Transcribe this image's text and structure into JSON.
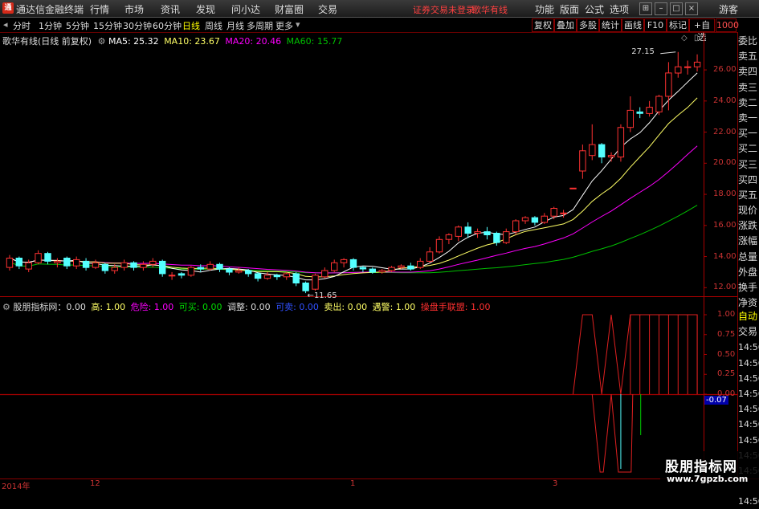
{
  "menubar": {
    "app_title": "通达信金融终端",
    "items": [
      "行情",
      "市场",
      "资讯",
      "发现",
      "问小达",
      "财富圈",
      "交易"
    ],
    "warning": "证券交易未登录",
    "stock_name": "歌华有线",
    "right_items": [
      "功能",
      "版面",
      "公式",
      "选项"
    ],
    "guest": "游客"
  },
  "periodbar": {
    "items": [
      "分时",
      "1分钟",
      "5分钟",
      "15分钟",
      "30分钟",
      "60分钟",
      "日线",
      "周线",
      "月线",
      "多周期",
      "更多"
    ],
    "active": "日线",
    "tools": [
      "复权",
      "叠加",
      "多股",
      "统计",
      "画线",
      "F10",
      "标记",
      "+自选"
    ]
  },
  "main_legend": {
    "title": "歌华有线(日线 前复权)",
    "ma5": "MA5: 25.32",
    "ma10": "MA10: 23.67",
    "ma20": "MA20: 20.46",
    "ma60": "MA60: 15.77",
    "high_label": "27.15",
    "low_label": "11.65"
  },
  "colors": {
    "up": "#ff3232",
    "down": "#54ffff",
    "ma5": "#ffffff",
    "ma10": "#ffff66",
    "ma20": "#ff00ff",
    "ma60": "#00c000",
    "frame": "#aa0000"
  },
  "price_axis": [
    "26.00",
    "24.00",
    "22.00",
    "20.00",
    "18.00",
    "16.00",
    "14.00",
    "12.00"
  ],
  "right_panel": [
    "委比",
    "卖五",
    "卖四",
    "卖三",
    "卖二",
    "卖一",
    "买一",
    "买二",
    "买三",
    "买四",
    "买五",
    "现价",
    "涨跌",
    "涨幅",
    "总量",
    "外盘",
    "换手",
    "净资",
    "收益"
  ],
  "right_panel_lower": [
    "自动",
    "交易"
  ],
  "time_labels": [
    "14:56",
    "14:56",
    "14:56",
    "14:56",
    "14:56",
    "14:56",
    "14:56",
    "14:56",
    "14:56",
    "14:56",
    "14:56"
  ],
  "indicator": {
    "name": "股朋指标网：0.00",
    "gao": "高: 1.00",
    "weixian": "危险: 1.00",
    "kemai": "可买: 0.00",
    "tiaozheng": "调整: 0.00",
    "kemai2": "可卖: 0.00",
    "maichu": "卖出: 0.00",
    "yujing": "遇警: 1.00",
    "caopan": "操盘手联盟: 1.00",
    "axis": [
      "1.00",
      "0.75",
      "0.50",
      "0.25",
      "0.00"
    ],
    "current": "-0.07"
  },
  "date_axis": [
    "2014年",
    "12",
    "1",
    "3"
  ],
  "watermark": {
    "line1": "股朋指标网",
    "line2": "www.7gpzb.com"
  },
  "chart_data": {
    "type": "candlestick",
    "title": "歌华有线(日线 前复权)",
    "ylim": [
      11.5,
      27.5
    ],
    "candles": [
      [
        13.3,
        13.9,
        13.1,
        14.1
      ],
      [
        13.9,
        13.4,
        13.2,
        14.0
      ],
      [
        13.2,
        13.6,
        13.0,
        13.8
      ],
      [
        13.6,
        14.2,
        13.5,
        14.4
      ],
      [
        14.2,
        13.7,
        13.5,
        14.3
      ],
      [
        13.6,
        13.7,
        13.3,
        13.9
      ],
      [
        13.9,
        13.4,
        13.2,
        14.0
      ],
      [
        13.4,
        13.8,
        13.2,
        14.0
      ],
      [
        13.7,
        13.3,
        13.1,
        13.9
      ],
      [
        13.3,
        13.6,
        13.2,
        13.8
      ],
      [
        13.5,
        13.1,
        12.9,
        13.6
      ],
      [
        13.1,
        13.3,
        12.9,
        13.5
      ],
      [
        13.3,
        13.6,
        13.1,
        13.8
      ],
      [
        13.6,
        13.3,
        13.1,
        13.7
      ],
      [
        13.3,
        13.5,
        13.1,
        13.7
      ],
      [
        13.5,
        13.7,
        13.3,
        13.9
      ],
      [
        13.7,
        12.9,
        12.7,
        13.8
      ],
      [
        12.8,
        12.8,
        12.5,
        13.0
      ],
      [
        12.9,
        12.8,
        12.6,
        13.0
      ],
      [
        12.8,
        13.3,
        12.7,
        13.4
      ],
      [
        13.3,
        13.2,
        13.0,
        13.5
      ],
      [
        13.2,
        13.5,
        13.1,
        13.7
      ],
      [
        13.5,
        13.2,
        13.0,
        13.6
      ],
      [
        13.2,
        13.0,
        12.8,
        13.3
      ],
      [
        13.0,
        13.1,
        12.9,
        13.3
      ],
      [
        13.1,
        12.9,
        12.7,
        13.2
      ],
      [
        12.9,
        12.6,
        12.4,
        13.0
      ],
      [
        12.6,
        12.8,
        12.5,
        13.0
      ],
      [
        12.8,
        12.7,
        12.5,
        12.9
      ],
      [
        12.7,
        12.9,
        12.5,
        13.0
      ],
      [
        12.9,
        12.3,
        12.1,
        13.0
      ],
      [
        12.3,
        11.8,
        11.65,
        12.4
      ],
      [
        11.9,
        12.8,
        11.8,
        12.9
      ],
      [
        12.7,
        13.1,
        12.6,
        13.3
      ],
      [
        13.1,
        13.6,
        13.0,
        13.8
      ],
      [
        13.6,
        13.8,
        13.3,
        13.9
      ],
      [
        13.8,
        13.3,
        13.1,
        13.9
      ],
      [
        13.3,
        13.2,
        13.0,
        13.4
      ],
      [
        13.2,
        13.0,
        12.9,
        13.3
      ],
      [
        13.0,
        13.1,
        12.9,
        13.2
      ],
      [
        13.1,
        13.3,
        13.0,
        13.4
      ],
      [
        13.3,
        13.4,
        13.2,
        13.5
      ],
      [
        13.4,
        13.2,
        13.1,
        13.6
      ],
      [
        13.3,
        13.7,
        13.2,
        13.9
      ],
      [
        13.7,
        14.3,
        13.6,
        14.6
      ],
      [
        14.3,
        15.1,
        14.2,
        15.3
      ],
      [
        15.1,
        15.4,
        14.8,
        15.5
      ],
      [
        15.3,
        15.9,
        15.0,
        16.0
      ],
      [
        15.9,
        15.5,
        15.2,
        16.2
      ],
      [
        15.5,
        15.6,
        15.2,
        15.8
      ],
      [
        15.6,
        15.4,
        15.1,
        15.9
      ],
      [
        15.5,
        14.9,
        14.7,
        15.6
      ],
      [
        14.9,
        15.6,
        14.8,
        15.8
      ],
      [
        15.6,
        16.3,
        15.4,
        16.4
      ],
      [
        16.3,
        16.5,
        16.1,
        16.6
      ],
      [
        16.5,
        16.2,
        16.0,
        16.6
      ],
      [
        16.2,
        16.6,
        16.1,
        16.8
      ],
      [
        16.6,
        17.1,
        16.4,
        17.2
      ],
      [
        16.8,
        16.8,
        16.5,
        17.0
      ],
      [
        18.4,
        18.4,
        18.4,
        18.4
      ],
      [
        19.5,
        20.8,
        19.0,
        21.2
      ],
      [
        20.5,
        21.2,
        20.2,
        22.5
      ],
      [
        21.2,
        20.4,
        20.0,
        21.3
      ],
      [
        20.4,
        20.5,
        20.1,
        20.7
      ],
      [
        20.4,
        22.3,
        20.1,
        22.5
      ],
      [
        22.3,
        23.4,
        22.0,
        24.3
      ],
      [
        23.3,
        23.2,
        22.9,
        23.6
      ],
      [
        23.2,
        23.6,
        23.0,
        24.0
      ],
      [
        23.3,
        24.3,
        23.1,
        24.4
      ],
      [
        24.3,
        25.8,
        23.4,
        26.5
      ],
      [
        25.8,
        26.2,
        25.5,
        27.15
      ],
      [
        26.2,
        26.2,
        25.7,
        26.6
      ],
      [
        26.2,
        26.5,
        25.9,
        27.0
      ]
    ],
    "ma": {
      "ma5": {
        "name": "MA5",
        "value": 25.32
      },
      "ma10": {
        "name": "MA10",
        "value": 23.67
      },
      "ma20": {
        "name": "MA20",
        "value": 20.46
      },
      "ma60": {
        "name": "MA60",
        "value": 15.77
      }
    }
  }
}
